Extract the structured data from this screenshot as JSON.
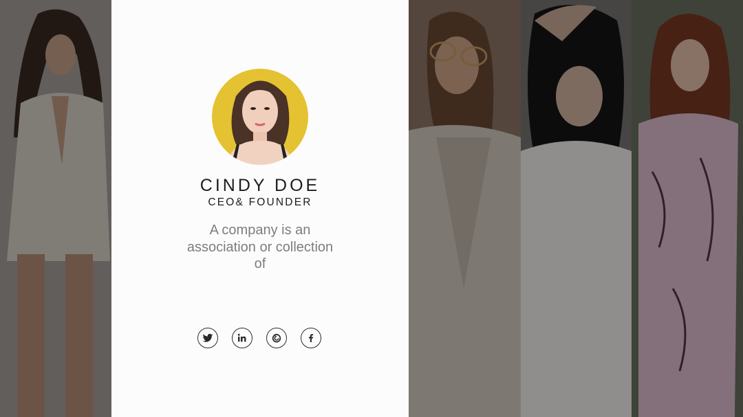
{
  "profile": {
    "name": "CINDY  DOE",
    "role": "CEO&  FOUNDER",
    "description": "A company is an association or collection of"
  },
  "socials": [
    {
      "icon": "twitter-icon"
    },
    {
      "icon": "linkedin-icon"
    },
    {
      "icon": "firefox-icon"
    },
    {
      "icon": "facebook-icon"
    }
  ],
  "colors": {
    "card_background": "#fdfcfc",
    "avatar_background": "#e5c231",
    "text_dark": "#1c1c1c",
    "text_muted": "#7d7d7d",
    "overlay": "rgba(0,0,0,0.42)"
  }
}
